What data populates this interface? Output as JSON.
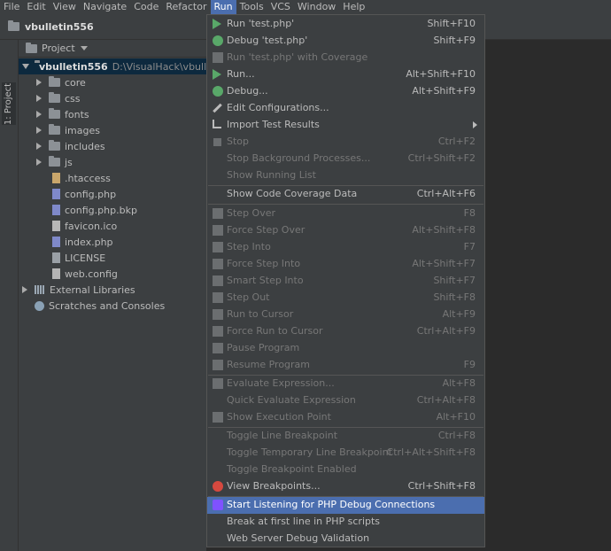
{
  "menubar": {
    "items": [
      "File",
      "Edit",
      "View",
      "Navigate",
      "Code",
      "Refactor",
      "Run",
      "Tools",
      "VCS",
      "Window",
      "Help"
    ],
    "active": "Run"
  },
  "navbar": {
    "project_name": "vbulletin556"
  },
  "side_strip": {
    "tab_label": "1: Project"
  },
  "project_panel": {
    "header_label": "Project",
    "root": {
      "name": "vbulletin556",
      "path": "D:\\VisualHack\\vbulletin"
    },
    "folders": [
      "core",
      "css",
      "fonts",
      "images",
      "includes",
      "js"
    ],
    "files": [
      {
        "name": ".htaccess",
        "icon": "htaccess-icon"
      },
      {
        "name": "config.php",
        "icon": "php-file-icon"
      },
      {
        "name": "config.php.bkp",
        "icon": "php-file-icon"
      },
      {
        "name": "favicon.ico",
        "icon": "ico-file-icon"
      },
      {
        "name": "index.php",
        "icon": "php-file-icon"
      },
      {
        "name": "LICENSE",
        "icon": "text-file-icon"
      },
      {
        "name": "web.config",
        "icon": "config-file-icon"
      }
    ],
    "external_libraries": "External Libraries",
    "scratches": "Scratches and Consoles"
  },
  "run_menu": {
    "items": [
      {
        "label": "Run 'test.php'",
        "shortcut": "Shift+F10",
        "enabled": true,
        "icon": "run-icon"
      },
      {
        "label": "Debug 'test.php'",
        "shortcut": "Shift+F9",
        "enabled": true,
        "icon": "debug-icon"
      },
      {
        "label": "Run 'test.php' with Coverage",
        "shortcut": "",
        "enabled": false,
        "icon": "coverage-icon"
      },
      {
        "label": "Run...",
        "shortcut": "Alt+Shift+F10",
        "enabled": true,
        "icon": "run-icon"
      },
      {
        "label": "Debug...",
        "shortcut": "Alt+Shift+F9",
        "enabled": true,
        "icon": "debug-icon"
      },
      {
        "label": "Edit Configurations...",
        "shortcut": "",
        "enabled": true,
        "icon": "edit-icon"
      },
      {
        "label": "Import Test Results",
        "shortcut": "",
        "enabled": true,
        "icon": "import-icon",
        "submenu": true
      },
      {
        "label": "Stop",
        "shortcut": "Ctrl+F2",
        "enabled": false,
        "icon": "stop-icon"
      },
      {
        "label": "Stop Background Processes...",
        "shortcut": "Ctrl+Shift+F2",
        "enabled": false,
        "icon": ""
      },
      {
        "label": "Show Running List",
        "shortcut": "",
        "enabled": false,
        "icon": ""
      },
      {
        "label": "Show Code Coverage Data",
        "shortcut": "Ctrl+Alt+F6",
        "enabled": true,
        "icon": ""
      },
      {
        "label": "Step Over",
        "shortcut": "F8",
        "enabled": false,
        "icon": "step-over-icon"
      },
      {
        "label": "Force Step Over",
        "shortcut": "Alt+Shift+F8",
        "enabled": false,
        "icon": "force-step-over-icon"
      },
      {
        "label": "Step Into",
        "shortcut": "F7",
        "enabled": false,
        "icon": "step-into-icon"
      },
      {
        "label": "Force Step Into",
        "shortcut": "Alt+Shift+F7",
        "enabled": false,
        "icon": "force-step-into-icon"
      },
      {
        "label": "Smart Step Into",
        "shortcut": "Shift+F7",
        "enabled": false,
        "icon": "smart-step-into-icon"
      },
      {
        "label": "Step Out",
        "shortcut": "Shift+F8",
        "enabled": false,
        "icon": "step-out-icon"
      },
      {
        "label": "Run to Cursor",
        "shortcut": "Alt+F9",
        "enabled": false,
        "icon": "run-to-cursor-icon"
      },
      {
        "label": "Force Run to Cursor",
        "shortcut": "Ctrl+Alt+F9",
        "enabled": false,
        "icon": "force-run-to-cursor-icon"
      },
      {
        "label": "Pause Program",
        "shortcut": "",
        "enabled": false,
        "icon": "pause-icon"
      },
      {
        "label": "Resume Program",
        "shortcut": "F9",
        "enabled": false,
        "icon": "resume-icon"
      },
      {
        "label": "Evaluate Expression...",
        "shortcut": "Alt+F8",
        "enabled": false,
        "icon": "evaluate-icon"
      },
      {
        "label": "Quick Evaluate Expression",
        "shortcut": "Ctrl+Alt+F8",
        "enabled": false,
        "icon": ""
      },
      {
        "label": "Show Execution Point",
        "shortcut": "Alt+F10",
        "enabled": false,
        "icon": "execution-point-icon"
      },
      {
        "label": "Toggle Line Breakpoint",
        "shortcut": "Ctrl+F8",
        "enabled": false,
        "icon": ""
      },
      {
        "label": "Toggle Temporary Line Breakpoint",
        "shortcut": "Ctrl+Alt+Shift+F8",
        "enabled": false,
        "icon": ""
      },
      {
        "label": "Toggle Breakpoint Enabled",
        "shortcut": "",
        "enabled": false,
        "icon": ""
      },
      {
        "label": "View Breakpoints...",
        "shortcut": "Ctrl+Shift+F8",
        "enabled": true,
        "icon": "breakpoints-icon"
      },
      {
        "label": "Start Listening for PHP Debug Connections",
        "shortcut": "",
        "enabled": true,
        "icon": "php-listen-icon",
        "highlighted": true
      },
      {
        "label": "Break at first line in PHP scripts",
        "shortcut": "",
        "enabled": true,
        "icon": ""
      },
      {
        "label": "Web Server Debug Validation",
        "shortcut": "",
        "enabled": true,
        "icon": ""
      }
    ]
  }
}
